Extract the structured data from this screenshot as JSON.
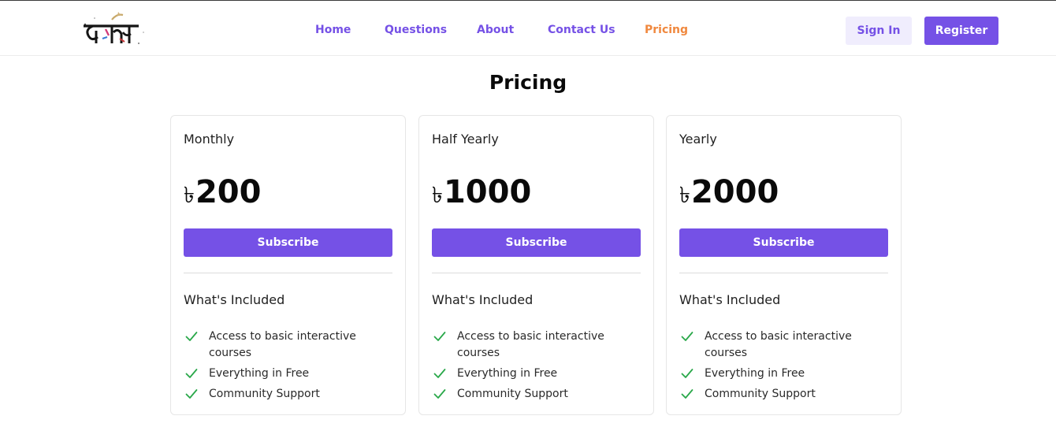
{
  "header": {
    "logo_name": "brand-logo",
    "nav": [
      {
        "label": "Home",
        "active": false
      },
      {
        "label": "Questions",
        "active": false
      },
      {
        "label": "About",
        "active": false
      },
      {
        "label": "Contact Us",
        "active": false
      },
      {
        "label": "Pricing",
        "active": true
      }
    ],
    "signin_label": "Sign In",
    "register_label": "Register"
  },
  "page": {
    "title": "Pricing"
  },
  "plans": [
    {
      "name": "Monthly",
      "currency": "৳",
      "amount": "200",
      "button": "Subscribe",
      "included_title": "What's Included",
      "features": [
        "Access to basic interactive courses",
        "Everything in Free",
        "Community Support"
      ]
    },
    {
      "name": "Half Yearly",
      "currency": "৳",
      "amount": "1000",
      "button": "Subscribe",
      "included_title": "What's Included",
      "features": [
        "Access to basic interactive courses",
        "Everything in Free",
        "Community Support"
      ]
    },
    {
      "name": "Yearly",
      "currency": "৳",
      "amount": "2000",
      "button": "Subscribe",
      "included_title": "What's Included",
      "features": [
        "Access to basic interactive courses",
        "Everything in Free",
        "Community Support"
      ]
    }
  ],
  "colors": {
    "accent": "#7551e6",
    "active_nav": "#f0883e",
    "signin_bg": "#f0edfd",
    "check": "#2aa84a"
  },
  "icons": {
    "feature": "check-icon"
  }
}
